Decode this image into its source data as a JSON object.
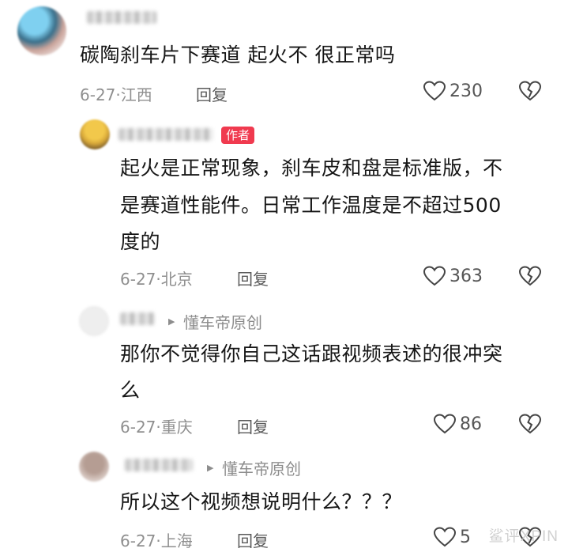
{
  "comments": [
    {
      "text": "碳陶刹车片下赛道 起火不 很正常吗",
      "date_location": "6-27·江西",
      "reply_label": "回复",
      "likes": "230"
    },
    {
      "author_tag": "作者",
      "text_lines": [
        "起火是正常现象，刹车皮和盘是标准版，不",
        "是赛道性能件。日常工作温度是不超过500",
        "度的"
      ],
      "date_location": "6-27·北京",
      "reply_label": "回复",
      "likes": "363"
    },
    {
      "reply_to": "懂车帝原创",
      "text_lines": [
        "那你不觉得你自己这话跟视频表述的很冲突",
        "么"
      ],
      "date_location": "6-27·重庆",
      "reply_label": "回复",
      "likes": "86"
    },
    {
      "reply_to": "懂车帝原创",
      "text": "所以这个视频想说明什么？？？",
      "date_location": "6-27·上海",
      "reply_label": "回复",
      "likes": "5"
    }
  ],
  "watermark": "鲨评XPIN",
  "icons": {
    "like": "heart-outline-icon",
    "dislike": "broken-heart-icon",
    "reply_to": "triangle-right-icon"
  }
}
